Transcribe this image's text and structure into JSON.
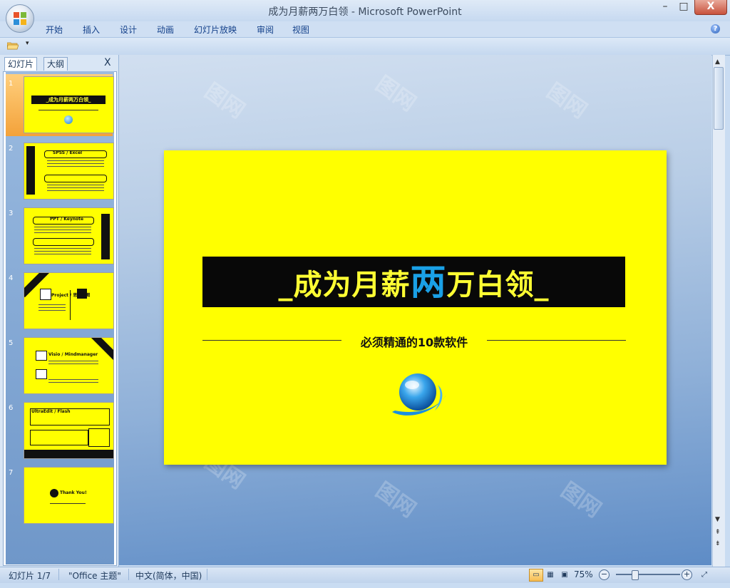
{
  "window": {
    "title": "成为月薪两万白领 - Microsoft PowerPoint",
    "minimize": "–",
    "maximize": "□",
    "close": "X"
  },
  "ribbon": {
    "tabs": [
      "开始",
      "插入",
      "设计",
      "动画",
      "幻灯片放映",
      "审阅",
      "视图"
    ],
    "help": "?"
  },
  "qat": {
    "customize": "▾"
  },
  "panel": {
    "tab_slides": "幻灯片",
    "tab_outline": "大纲",
    "close": "X",
    "thumbnails": [
      {
        "num": "1",
        "text": "_成为月薪两万白领_"
      },
      {
        "num": "2",
        "text": "SPSS / Excel"
      },
      {
        "num": "3",
        "text": "PPT / Keynote"
      },
      {
        "num": "4",
        "text": "Project / 思维导图"
      },
      {
        "num": "5",
        "text": "Visio / Mindmanager"
      },
      {
        "num": "6",
        "text": "UltraEdit / Flash"
      },
      {
        "num": "7",
        "text": "Thank You!"
      }
    ]
  },
  "slide": {
    "title_pre": "_成为月薪",
    "title_hi": "两",
    "title_post": "万白领_",
    "subtitle": "必须精通的10款软件"
  },
  "watermark": "图网",
  "status": {
    "slide_counter": "幻灯片 1/7",
    "theme": "\"Office 主题\"",
    "language": "中文(简体，中国)",
    "zoom": "75%",
    "zoom_out": "−",
    "zoom_in": "+"
  },
  "colors": {
    "slide_bg": "#ffff00",
    "title_text": "#ffff33",
    "title_highlight": "#1aa0e6",
    "banner": "#080808",
    "selection": "#f7a334"
  }
}
